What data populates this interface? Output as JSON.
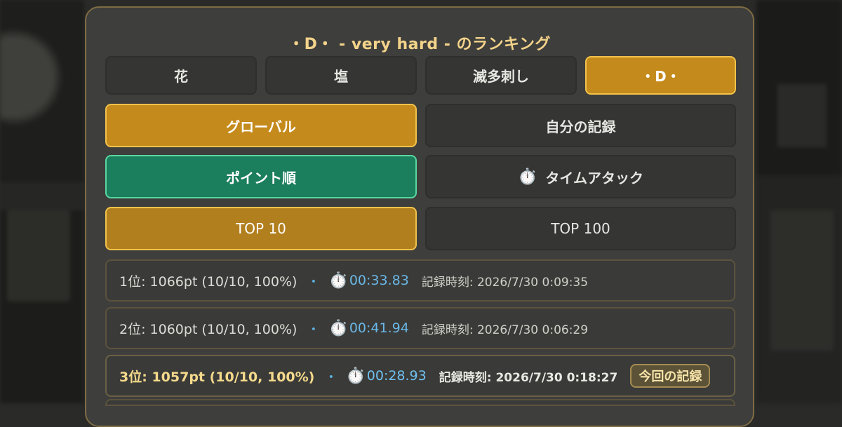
{
  "title": "・D・ - very hard - のランキング",
  "stage_tabs": [
    {
      "label": "花",
      "selected": false
    },
    {
      "label": "塩",
      "selected": false
    },
    {
      "label": "滅多刺し",
      "selected": false
    },
    {
      "label": "・D・",
      "selected": true
    }
  ],
  "scope_tabs": [
    {
      "label": "グローバル",
      "selected": true
    },
    {
      "label": "自分の記録",
      "selected": false
    }
  ],
  "mode_tabs": [
    {
      "label": "ポイント順",
      "selected": true
    },
    {
      "label": "タイムアタック",
      "icon": "⏱️",
      "icon_name": "stopwatch-icon",
      "selected": false
    }
  ],
  "range_tabs": [
    {
      "label": "TOP 10",
      "selected": true
    },
    {
      "label": "TOP 100",
      "selected": false
    }
  ],
  "entries": [
    {
      "rank": "1位: 1066pt (10/10, 100%)",
      "sep": "・",
      "timer_icon": "⏱️",
      "time": "00:33.83",
      "recorded": "記録時刻: 2026/7/30 0:09:35"
    },
    {
      "rank": "2位: 1060pt (10/10, 100%)",
      "sep": "・",
      "timer_icon": "⏱️",
      "time": "00:41.94",
      "recorded": "記録時刻: 2026/7/30 0:06:29"
    },
    {
      "rank": "3位: 1057pt (10/10, 100%)",
      "sep": "・",
      "timer_icon": "⏱️",
      "time": "00:28.93",
      "recorded": "記録時刻: 2026/7/30 0:18:27",
      "badge": "今回の記録"
    }
  ],
  "colors": {
    "accent_gold": "#c48a1c",
    "accent_green": "#1b7e5c",
    "title": "#f3d38a",
    "time": "#69b8e8"
  }
}
